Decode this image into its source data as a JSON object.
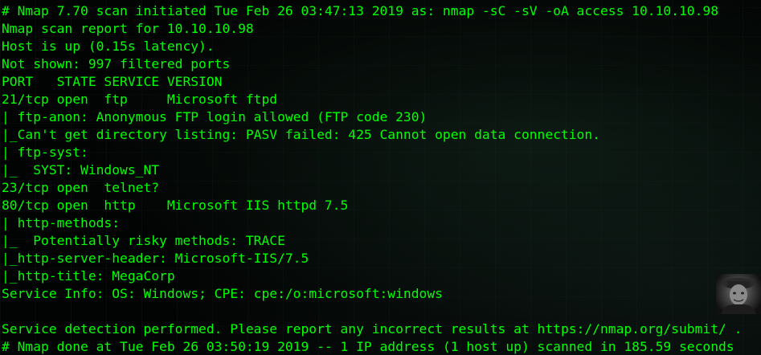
{
  "terminal": {
    "lines": [
      "# Nmap 7.70 scan initiated Tue Feb 26 03:47:13 2019 as: nmap -sC -sV -oA access 10.10.10.98",
      "Nmap scan report for 10.10.10.98",
      "Host is up (0.15s latency).",
      "Not shown: 997 filtered ports",
      "PORT   STATE SERVICE VERSION",
      "21/tcp open  ftp     Microsoft ftpd",
      "| ftp-anon: Anonymous FTP login allowed (FTP code 230)",
      "|_Can't get directory listing: PASV failed: 425 Cannot open data connection.",
      "| ftp-syst:",
      "|_  SYST: Windows_NT",
      "23/tcp open  telnet?",
      "80/tcp open  http    Microsoft IIS httpd 7.5",
      "| http-methods:",
      "|_  Potentially risky methods: TRACE",
      "|_http-server-header: Microsoft-IIS/7.5",
      "|_http-title: MegaCorp",
      "Service Info: OS: Windows; CPE: cpe:/o:microsoft:windows",
      "",
      "Service detection performed. Please report any incorrect results at https://nmap.org/submit/ .",
      "# Nmap done at Tue Feb 26 03:50:19 2019 -- 1 IP address (1 host up) scanned in 185.59 seconds"
    ]
  },
  "colors": {
    "text": "#00ff00",
    "background": "#020403"
  },
  "icons": {
    "corner_image": "avatar-photo"
  }
}
